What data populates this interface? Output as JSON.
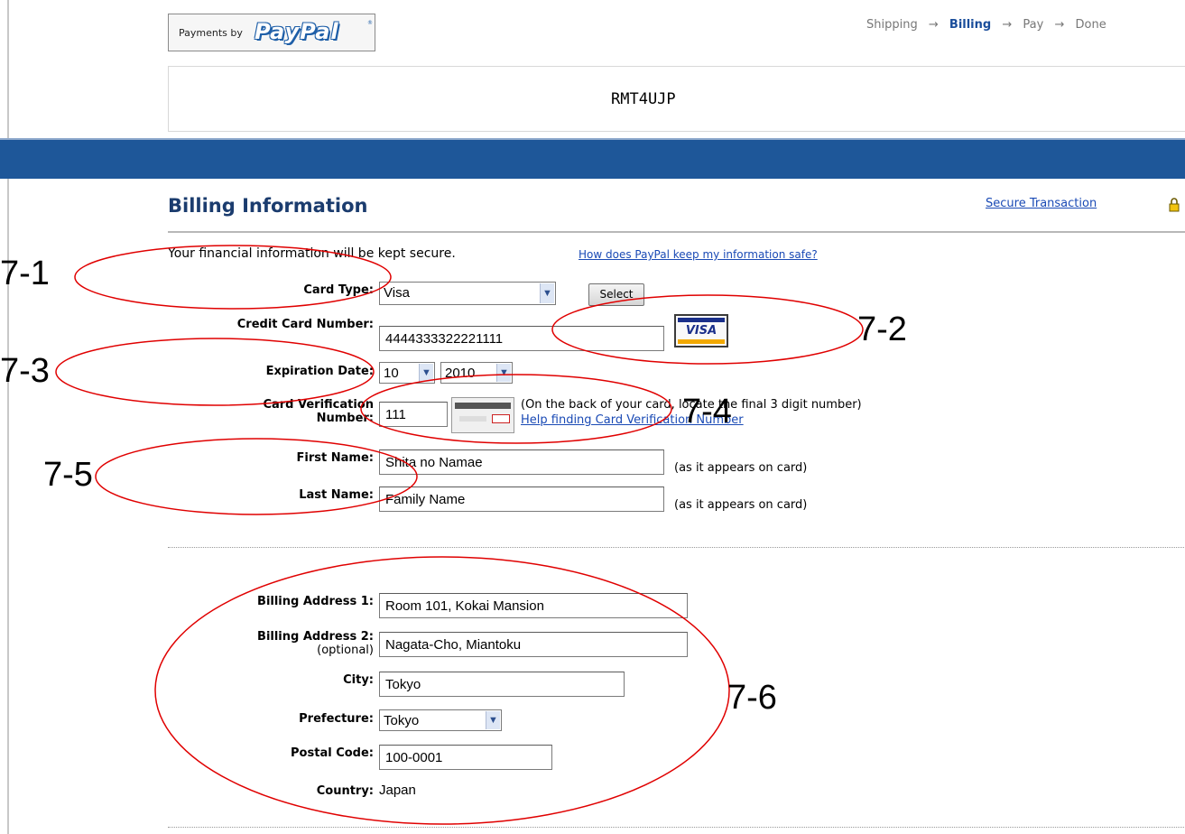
{
  "header": {
    "logo_prefix": "Payments by",
    "logo_word": "PayPal",
    "logo_reg": "®",
    "steps": [
      "Shipping",
      "Billing",
      "Pay",
      "Done"
    ],
    "step_arrow": "→",
    "active_step": "Billing",
    "merchant_name": "RMT4UJP"
  },
  "section": {
    "title": "Billing Information",
    "secure_link": "Secure Transaction",
    "intro": "Your financial information will be kept secure.",
    "intro_link": "How does PayPal keep my information safe?"
  },
  "card": {
    "type_label": "Card Type:",
    "type_value": "Visa",
    "select_button": "Select",
    "number_label": "Credit Card Number:",
    "number_value": "4444333322221111",
    "visa_logo_text": "VISA",
    "expiration_label": "Expiration Date:",
    "exp_month": "10",
    "exp_year": "2010",
    "cvn_label_line1": "Card Verification",
    "cvn_label_line2": "Number:",
    "cvn_value": "111",
    "cvn_note": "(On the back of your card, locate the final 3 digit number)",
    "cvn_help": "Help finding Card Verification Number",
    "first_name_label": "First Name:",
    "first_name_value": "Shita no Namae",
    "last_name_label": "Last Name:",
    "last_name_value": "Family Name",
    "as_on_card": "(as it appears on card)"
  },
  "address": {
    "addr1_label": "Billing Address 1:",
    "addr1_value": "Room 101, Kokai Mansion",
    "addr2_label": "Billing Address 2:",
    "addr2_optional": "(optional)",
    "addr2_value": "Nagata-Cho, Miantoku",
    "city_label": "City:",
    "city_value": "Tokyo",
    "prefecture_label": "Prefecture:",
    "prefecture_value": "Tokyo",
    "postal_label": "Postal Code:",
    "postal_value": "100-0001",
    "country_label": "Country:",
    "country_value": "Japan"
  },
  "annotations": {
    "a1": "7-1",
    "a2": "7-2",
    "a3": "7-3",
    "a4": "7-4",
    "a5": "7-5",
    "a6": "7-6"
  },
  "icons": {
    "dropdown": "▼",
    "lock": "lock-icon"
  },
  "colors": {
    "bar": "#1e5799",
    "heading": "#1b3c6e",
    "link": "#1a4ab5",
    "annotation": "#e00000"
  }
}
